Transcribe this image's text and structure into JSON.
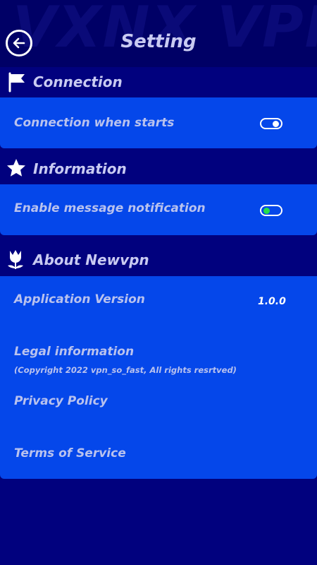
{
  "header": {
    "watermark": "VXNX VPN",
    "title": "Setting"
  },
  "sections": {
    "connection": {
      "title": "Connection",
      "row_label": "Connection when starts"
    },
    "information": {
      "title": "Information",
      "row_label": "Enable message notification"
    },
    "about": {
      "title": "About Newvpn",
      "version_label": "Application Version",
      "version_value": "1.0.0",
      "legal_label": "Legal information",
      "legal_sub": "(Copyright 2022 vpn_so_fast, All rights resrtved)",
      "privacy_label": "Privacy Policy",
      "terms_label": "Terms of Service"
    }
  },
  "colors": {
    "background": "#01017e",
    "header": "#000066",
    "card": "#0547ea",
    "text": "#c9cbf2",
    "toggle_on_knob": "#ffffff",
    "toggle_green": "#25e04a"
  }
}
